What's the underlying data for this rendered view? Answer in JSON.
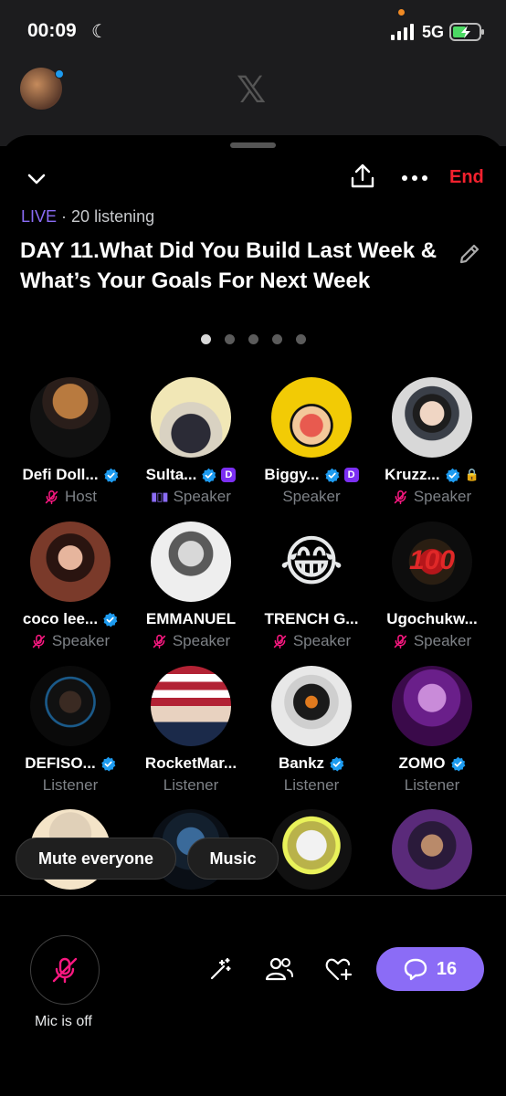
{
  "status_bar": {
    "time": "00:09",
    "network": "5G"
  },
  "space": {
    "live_label": "LIVE",
    "listening": "· 20 listening",
    "title": "DAY 11.What Did You Build Last Week & What’s Your Goals For Next Week",
    "end_label": "End",
    "page_count": 5,
    "active_page": 0
  },
  "participants": [
    {
      "name": "Defi Doll...",
      "role": "Host",
      "verified": true,
      "mic": "off"
    },
    {
      "name": "Sulta...",
      "role": "Speaker",
      "verified": true,
      "badge": "D",
      "mic": "speaking"
    },
    {
      "name": "Biggy...",
      "role": "Speaker",
      "verified": true,
      "badge": "D",
      "mic": "none"
    },
    {
      "name": "Kruzz...",
      "role": "Speaker",
      "verified": true,
      "lock": true,
      "mic": "off"
    },
    {
      "name": "coco lee...",
      "role": "Speaker",
      "verified": true,
      "mic": "off"
    },
    {
      "name": "EMMANUEL",
      "role": "Speaker",
      "verified": false,
      "mic": "off"
    },
    {
      "name": "TRENCH G...",
      "role": "Speaker",
      "verified": false,
      "mic": "off",
      "emoji": "😂"
    },
    {
      "name": "Ugochukw...",
      "role": "Speaker",
      "verified": false,
      "mic": "off",
      "avatar_text": "100"
    },
    {
      "name": "DEFISO...",
      "role": "Listener",
      "verified": true,
      "mic": "none"
    },
    {
      "name": "RocketMar...",
      "role": "Listener",
      "verified": false,
      "mic": "none"
    },
    {
      "name": "Bankz",
      "role": "Listener",
      "verified": true,
      "mic": "none"
    },
    {
      "name": "ZOMO",
      "role": "Listener",
      "verified": true,
      "mic": "none"
    }
  ],
  "controls": {
    "mute_everyone": "Mute everyone",
    "music": "Music",
    "mic_status": "Mic is off",
    "reply_count": "16"
  },
  "colors": {
    "accent": "#8b6cf6",
    "end": "#f4212e",
    "verified": "#1d9bf0",
    "mic_off": "#f91880"
  }
}
